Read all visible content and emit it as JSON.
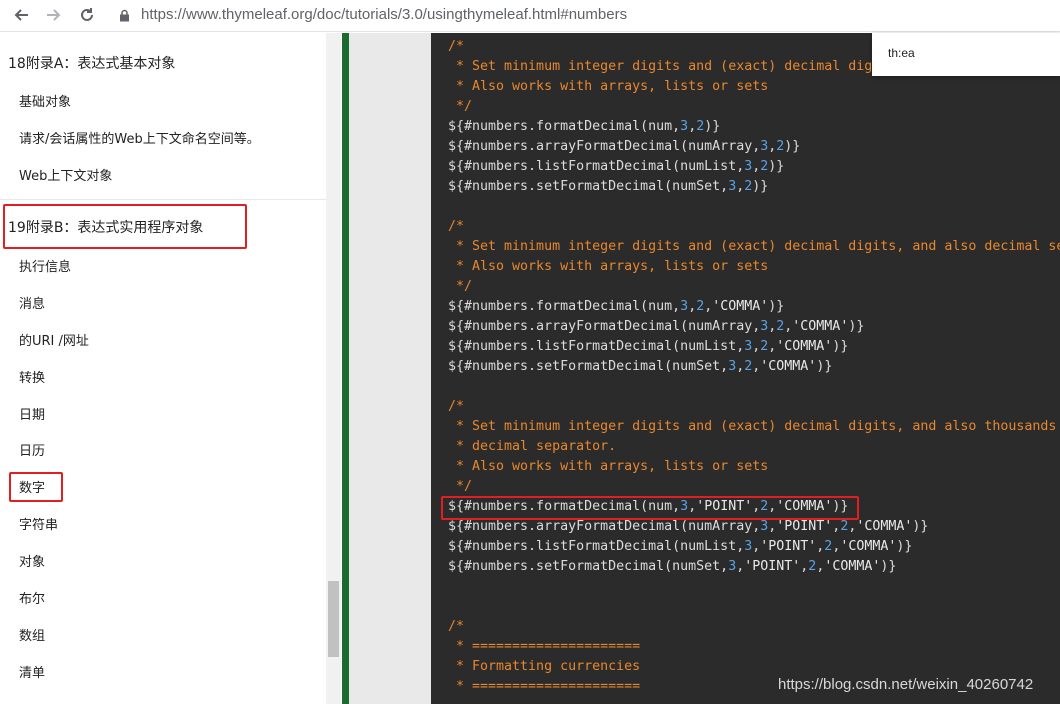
{
  "browser": {
    "url": "https://www.thymeleaf.org/doc/tutorials/3.0/usingthymeleaf.html#numbers"
  },
  "sidebar": {
    "head_a": "18附录A：表达式基本对象",
    "items_a": [
      "基础对象",
      "请求/会话属性的Web上下文命名空间等。",
      "Web上下文对象"
    ],
    "head_b": "19附录B：表达式实用程序对象",
    "items_b": [
      "执行信息",
      "消息",
      "的URI /网址",
      "转换",
      "日期",
      "日历",
      "数字",
      "字符串",
      "对象",
      "布尔",
      "数组",
      "清单"
    ]
  },
  "popup": {
    "text": "th:ea"
  },
  "code_lines": [
    [
      {
        "t": "/*",
        "c": "cm"
      }
    ],
    [
      {
        "t": " * Set minimum integer digits and (exact) decimal dig",
        "c": "cm"
      }
    ],
    [
      {
        "t": " * Also works with arrays, lists or sets",
        "c": "cm"
      }
    ],
    [
      {
        "t": " */",
        "c": "cm"
      }
    ],
    [
      {
        "t": "${#numbers.formatDecimal(num,",
        "c": ""
      },
      {
        "t": "3",
        "c": "num"
      },
      {
        "t": ",",
        "c": ""
      },
      {
        "t": "2",
        "c": "num"
      },
      {
        "t": ")}",
        "c": ""
      }
    ],
    [
      {
        "t": "${#numbers.arrayFormatDecimal(numArray,",
        "c": ""
      },
      {
        "t": "3",
        "c": "num"
      },
      {
        "t": ",",
        "c": ""
      },
      {
        "t": "2",
        "c": "num"
      },
      {
        "t": ")}",
        "c": ""
      }
    ],
    [
      {
        "t": "${#numbers.listFormatDecimal(numList,",
        "c": ""
      },
      {
        "t": "3",
        "c": "num"
      },
      {
        "t": ",",
        "c": ""
      },
      {
        "t": "2",
        "c": "num"
      },
      {
        "t": ")}",
        "c": ""
      }
    ],
    [
      {
        "t": "${#numbers.setFormatDecimal(numSet,",
        "c": ""
      },
      {
        "t": "3",
        "c": "num"
      },
      {
        "t": ",",
        "c": ""
      },
      {
        "t": "2",
        "c": "num"
      },
      {
        "t": ")}",
        "c": ""
      }
    ],
    [],
    [
      {
        "t": "/*",
        "c": "cm"
      }
    ],
    [
      {
        "t": " * Set minimum integer digits and (exact) decimal digits, and also decimal se",
        "c": "cm"
      }
    ],
    [
      {
        "t": " * Also works with arrays, lists or sets",
        "c": "cm"
      }
    ],
    [
      {
        "t": " */",
        "c": "cm"
      }
    ],
    [
      {
        "t": "${#numbers.formatDecimal(num,",
        "c": ""
      },
      {
        "t": "3",
        "c": "num"
      },
      {
        "t": ",",
        "c": ""
      },
      {
        "t": "2",
        "c": "num"
      },
      {
        "t": ",",
        "c": ""
      },
      {
        "t": "'COMMA'",
        "c": "str"
      },
      {
        "t": ")}",
        "c": ""
      }
    ],
    [
      {
        "t": "${#numbers.arrayFormatDecimal(numArray,",
        "c": ""
      },
      {
        "t": "3",
        "c": "num"
      },
      {
        "t": ",",
        "c": ""
      },
      {
        "t": "2",
        "c": "num"
      },
      {
        "t": ",",
        "c": ""
      },
      {
        "t": "'COMMA'",
        "c": "str"
      },
      {
        "t": ")}",
        "c": ""
      }
    ],
    [
      {
        "t": "${#numbers.listFormatDecimal(numList,",
        "c": ""
      },
      {
        "t": "3",
        "c": "num"
      },
      {
        "t": ",",
        "c": ""
      },
      {
        "t": "2",
        "c": "num"
      },
      {
        "t": ",",
        "c": ""
      },
      {
        "t": "'COMMA'",
        "c": "str"
      },
      {
        "t": ")}",
        "c": ""
      }
    ],
    [
      {
        "t": "${#numbers.setFormatDecimal(numSet,",
        "c": ""
      },
      {
        "t": "3",
        "c": "num"
      },
      {
        "t": ",",
        "c": ""
      },
      {
        "t": "2",
        "c": "num"
      },
      {
        "t": ",",
        "c": ""
      },
      {
        "t": "'COMMA'",
        "c": "str"
      },
      {
        "t": ")}",
        "c": ""
      }
    ],
    [],
    [
      {
        "t": "/*",
        "c": "cm"
      }
    ],
    [
      {
        "t": " * Set minimum integer digits and (exact) decimal digits, and also thousands",
        "c": "cm"
      }
    ],
    [
      {
        "t": " * decimal separator.",
        "c": "cm"
      }
    ],
    [
      {
        "t": " * Also works with arrays, lists or sets",
        "c": "cm"
      }
    ],
    [
      {
        "t": " */",
        "c": "cm"
      }
    ],
    [
      {
        "t": "${#numbers.formatDecimal(num,",
        "c": ""
      },
      {
        "t": "3",
        "c": "num"
      },
      {
        "t": ",",
        "c": ""
      },
      {
        "t": "'POINT'",
        "c": "str"
      },
      {
        "t": ",",
        "c": ""
      },
      {
        "t": "2",
        "c": "num"
      },
      {
        "t": ",",
        "c": ""
      },
      {
        "t": "'COMMA'",
        "c": "str"
      },
      {
        "t": ")}",
        "c": ""
      }
    ],
    [
      {
        "t": "${#numbers.arrayFormatDecimal(numArray,",
        "c": ""
      },
      {
        "t": "3",
        "c": "num"
      },
      {
        "t": ",",
        "c": ""
      },
      {
        "t": "'POINT'",
        "c": "str"
      },
      {
        "t": ",",
        "c": ""
      },
      {
        "t": "2",
        "c": "num"
      },
      {
        "t": ",",
        "c": ""
      },
      {
        "t": "'COMMA'",
        "c": "str"
      },
      {
        "t": ")}",
        "c": ""
      }
    ],
    [
      {
        "t": "${#numbers.listFormatDecimal(numList,",
        "c": ""
      },
      {
        "t": "3",
        "c": "num"
      },
      {
        "t": ",",
        "c": ""
      },
      {
        "t": "'POINT'",
        "c": "str"
      },
      {
        "t": ",",
        "c": ""
      },
      {
        "t": "2",
        "c": "num"
      },
      {
        "t": ",",
        "c": ""
      },
      {
        "t": "'COMMA'",
        "c": "str"
      },
      {
        "t": ")}",
        "c": ""
      }
    ],
    [
      {
        "t": "${#numbers.setFormatDecimal(numSet,",
        "c": ""
      },
      {
        "t": "3",
        "c": "num"
      },
      {
        "t": ",",
        "c": ""
      },
      {
        "t": "'POINT'",
        "c": "str"
      },
      {
        "t": ",",
        "c": ""
      },
      {
        "t": "2",
        "c": "num"
      },
      {
        "t": ",",
        "c": ""
      },
      {
        "t": "'COMMA'",
        "c": "str"
      },
      {
        "t": ")}",
        "c": ""
      }
    ],
    [],
    [],
    [
      {
        "t": "/*",
        "c": "cm"
      }
    ],
    [
      {
        "t": " * =====================",
        "c": "cm"
      }
    ],
    [
      {
        "t": " * Formatting currencies",
        "c": "cm"
      }
    ],
    [
      {
        "t": " * =====================",
        "c": "cm"
      }
    ]
  ],
  "watermark": "https://blog.csdn.net/weixin_40260742",
  "icons": [
    "back-arrow-icon",
    "forward-arrow-icon",
    "reload-icon",
    "lock-icon"
  ]
}
